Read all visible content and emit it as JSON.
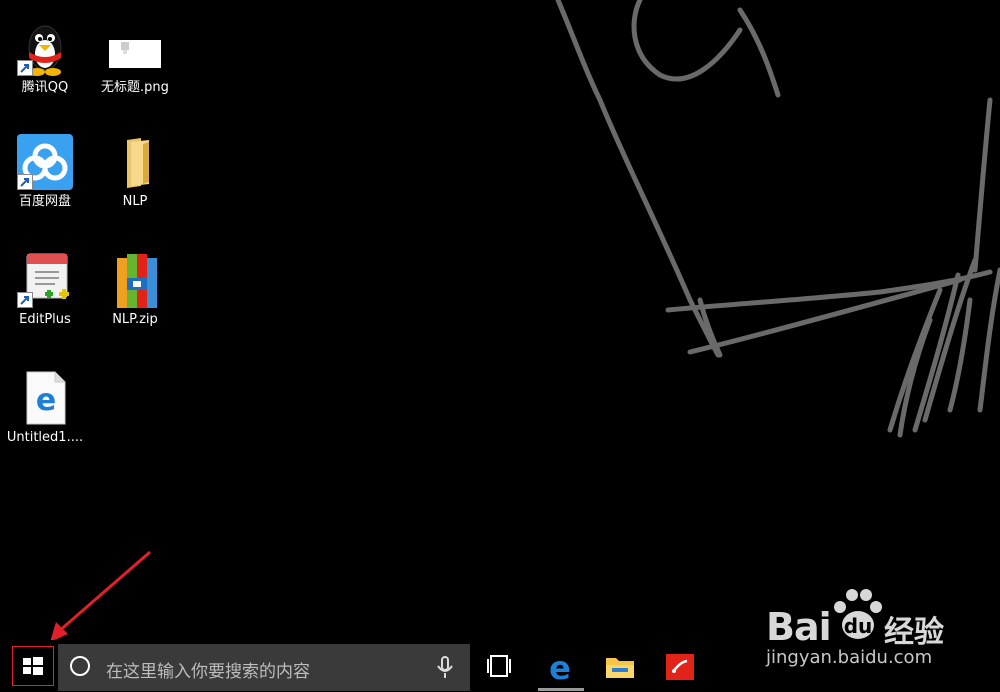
{
  "desktop": {
    "icons": [
      {
        "label": "腾讯QQ",
        "icon": "qq-penguin-icon",
        "shortcut": true
      },
      {
        "label": "无标题.png",
        "icon": "png-file-icon",
        "shortcut": false
      },
      {
        "label": "百度网盘",
        "icon": "baidu-netdisk-icon",
        "shortcut": true
      },
      {
        "label": "NLP",
        "icon": "folder-icon",
        "shortcut": false
      },
      {
        "label": "EditPlus",
        "icon": "editplus-icon",
        "shortcut": true
      },
      {
        "label": "NLP.zip",
        "icon": "zip-archive-icon",
        "shortcut": false
      },
      {
        "label": "Untitled1....",
        "icon": "edge-html-file-icon",
        "shortcut": false
      }
    ]
  },
  "taskbar": {
    "search_placeholder": "在这里输入你要搜索的内容",
    "pinned": [
      "task-view-icon",
      "edge-browser-icon",
      "file-explorer-icon",
      "red-app-icon"
    ]
  },
  "watermark": {
    "brand_left": "Bai",
    "brand_right": "经验",
    "url": "jingyan.baidu.com"
  },
  "colors": {
    "highlight": "#e0202a",
    "search_bg": "#3a3a3a",
    "edge_blue": "#1e7fd6"
  }
}
